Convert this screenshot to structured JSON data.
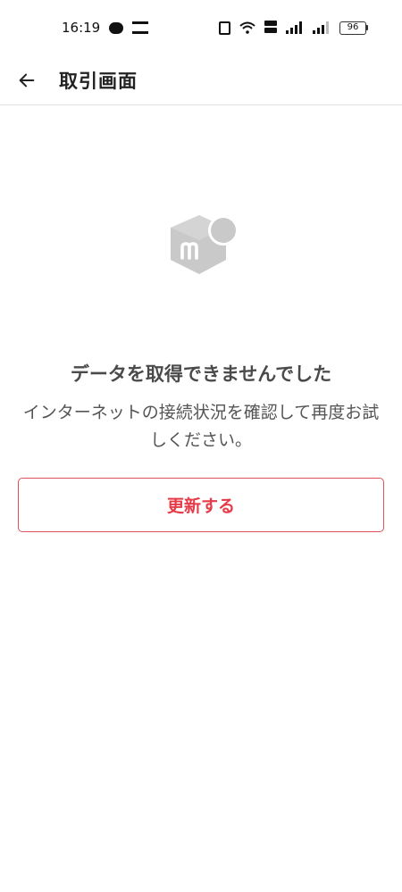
{
  "status_bar": {
    "time": "16:19",
    "battery_level": "96",
    "volte_label": "VoLTE",
    "icons": [
      "line-icon",
      "s-icon",
      "nfc-icon",
      "wifi-icon",
      "volte-icon",
      "signal-icon",
      "signal-icon",
      "battery-icon"
    ]
  },
  "app_bar": {
    "title": "取引画面",
    "back_icon": "arrow-left-icon"
  },
  "error": {
    "logo_icon": "mercari-logo-icon",
    "title": "データを取得できませんでした",
    "message": "インターネットの接続状況を確認して再度お試しください。",
    "button_label": "更新する"
  },
  "colors": {
    "accent": "#e53a47",
    "logo_gray": "#c9c9c9",
    "divider": "#e0e0e0",
    "title_text": "#4a4a4a",
    "body_text": "#555555"
  }
}
